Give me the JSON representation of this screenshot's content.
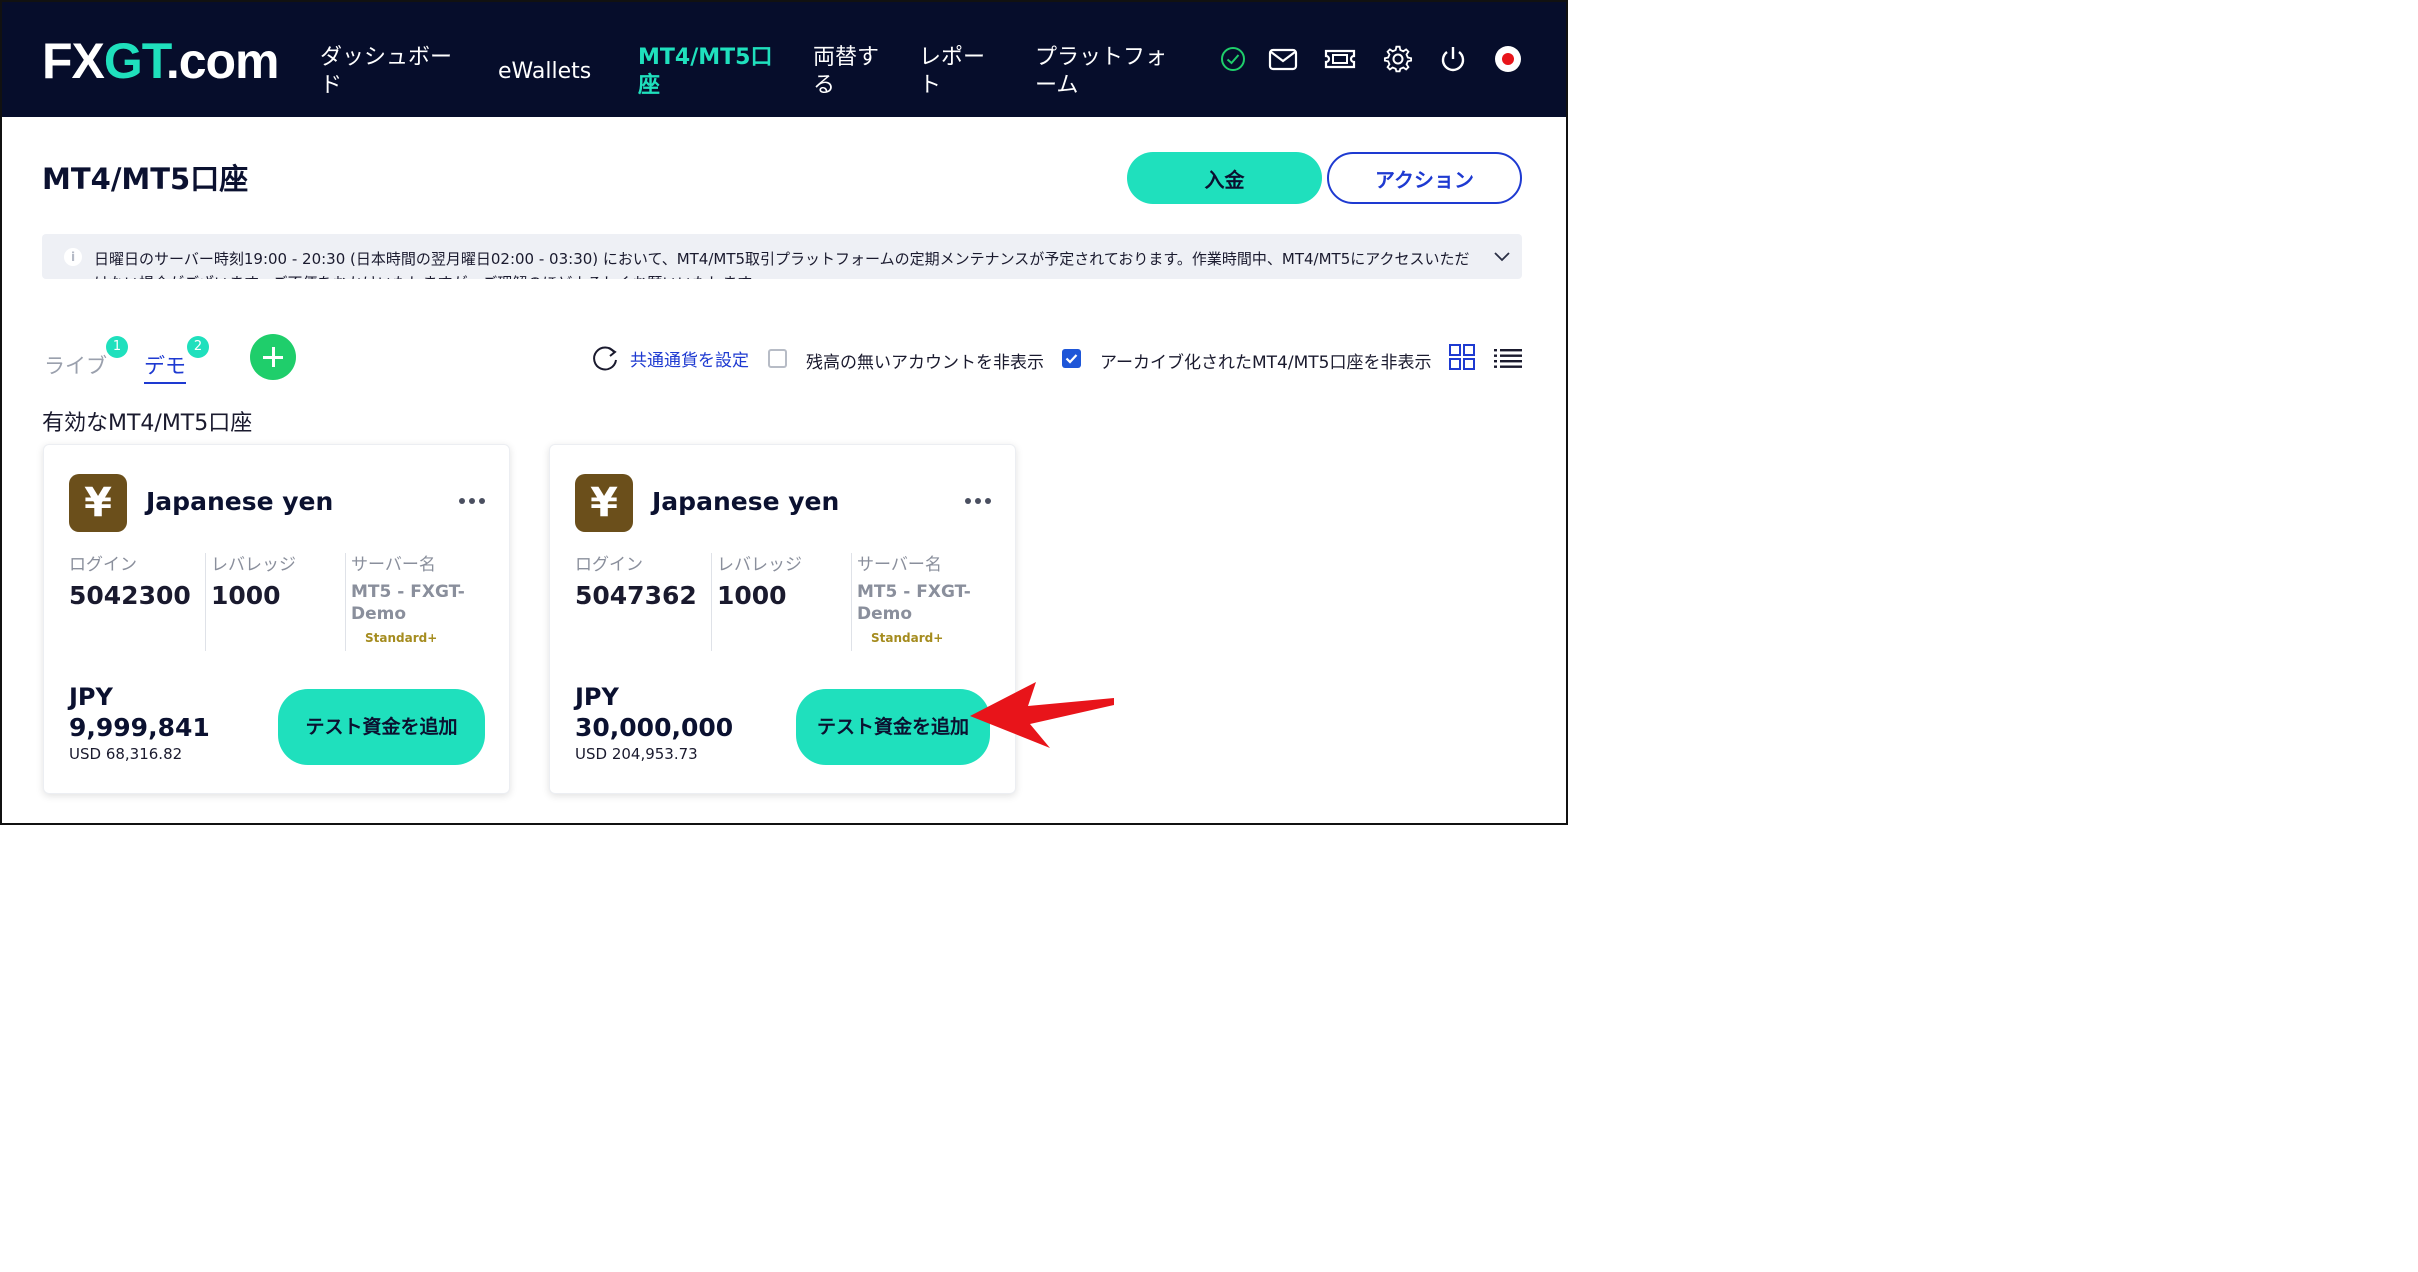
{
  "header": {
    "logo_left": "FX",
    "logo_accent": "GT",
    "logo_right": ".com",
    "nav": [
      {
        "line1": "ダッシュボー",
        "line2": "ド"
      },
      {
        "line1": "eWallets",
        "line2": ""
      },
      {
        "line1": "MT4/MT5口",
        "line2": "座"
      },
      {
        "line1": "両替す",
        "line2": "る"
      },
      {
        "line1": "レポー",
        "line2": "ト"
      },
      {
        "line1": "プラットフォ",
        "line2": "ーム"
      }
    ],
    "icons": [
      "verified-check-icon",
      "mail-icon",
      "ticket-icon",
      "settings-gear-icon",
      "power-icon",
      "japan-flag-icon"
    ]
  },
  "page": {
    "title": "MT4/MT5口座",
    "deposit_label": "入金",
    "action_label": "アクション"
  },
  "notice": {
    "text": "日曜日のサーバー時刻19:00 - 20:30 (日本時間の翌月曜日02:00 - 03:30) において、MT4/MT5取引プラットフォームの定期メンテナンスが予定されております。作業時間中、MT4/MT5にアクセスいただけない場合がございます。ご不便をおかけいたしますが、ご理解のほどよろしくお願いいたします。"
  },
  "tabs": [
    {
      "label": "ライブ",
      "count": "1"
    },
    {
      "label": "デモ",
      "count": "2"
    }
  ],
  "toolbar": {
    "set_currency": "共通通貨を設定",
    "hide_zero": "残高の無いアカウントを非表示",
    "hide_archived": "アーカイブ化されたMT4/MT5口座を非表示"
  },
  "section_title": "有効なMT4/MT5口座",
  "labels": {
    "login": "ログイン",
    "leverage": "レバレッジ",
    "server": "サーバー名",
    "add_funds": "テスト資金を追加"
  },
  "accounts": [
    {
      "currency_symbol": "¥",
      "currency_name": "Japanese yen",
      "login": "5042300",
      "leverage": "1000",
      "server": "MT5 - FXGT-Demo",
      "type": "Standard+",
      "balance_currency": "JPY",
      "balance": "9,999,841",
      "balance_usd": "USD 68,316.82"
    },
    {
      "currency_symbol": "¥",
      "currency_name": "Japanese yen",
      "login": "5047362",
      "leverage": "1000",
      "server": "MT5 - FXGT-Demo",
      "type": "Standard+",
      "balance_currency": "JPY",
      "balance": "30,000,000",
      "balance_usd": "USD 204,953.73"
    }
  ],
  "colors": {
    "header_bg": "#060d2b",
    "accent_teal": "#1fe0bd",
    "link_blue": "#1e3ad1",
    "add_green": "#1fce6b",
    "yen_icon_bg": "#6b4f1b",
    "annotation_red": "#e8141a"
  }
}
